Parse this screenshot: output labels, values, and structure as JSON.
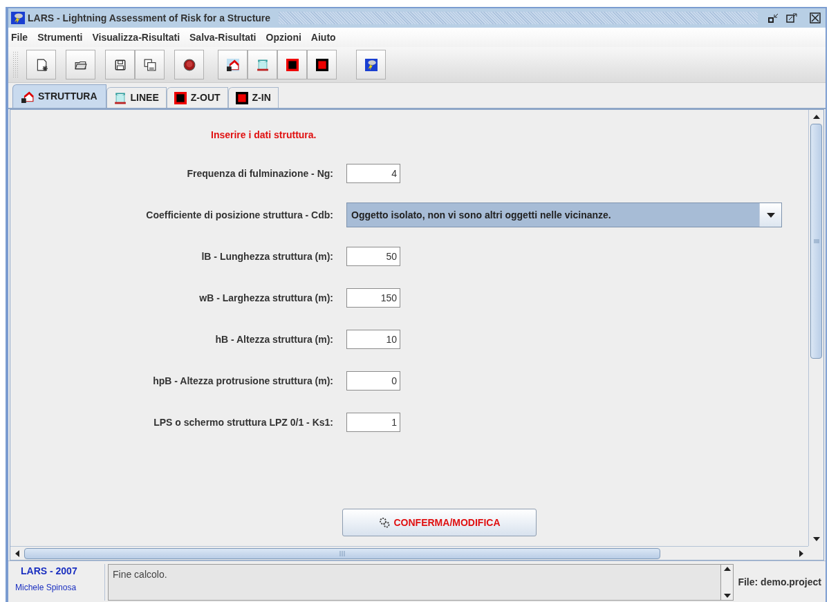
{
  "window": {
    "title": "LARS - Lightning Assessment of Risk for a Structure"
  },
  "menu": [
    {
      "label": "File"
    },
    {
      "label": "Strumenti"
    },
    {
      "label": "Visualizza-Risultati"
    },
    {
      "label": "Salva-Risultati"
    },
    {
      "label": "Opzioni"
    },
    {
      "label": "Aiuto"
    }
  ],
  "tabs": [
    {
      "label": "STRUTTURA",
      "selected": true
    },
    {
      "label": "LINEE",
      "selected": false
    },
    {
      "label": "Z-OUT",
      "selected": false
    },
    {
      "label": "Z-IN",
      "selected": false
    }
  ],
  "form": {
    "heading": "Inserire i dati struttura.",
    "fields": [
      {
        "kind": "text",
        "label": "Frequenza di fulminazione - Ng:",
        "value": "4"
      },
      {
        "kind": "select",
        "label": "Coefficiente di posizione struttura - Cdb:",
        "value": "Oggetto isolato, non vi sono altri oggetti nelle vicinanze."
      },
      {
        "kind": "text",
        "label": "lB - Lunghezza struttura (m):",
        "value": "50"
      },
      {
        "kind": "text",
        "label": "wB - Larghezza struttura (m):",
        "value": "150"
      },
      {
        "kind": "text",
        "label": "hB - Altezza struttura (m):",
        "value": "10"
      },
      {
        "kind": "text",
        "label": "hpB - Altezza protrusione struttura (m):",
        "value": "0"
      },
      {
        "kind": "text",
        "label": "LPS o schermo struttura  LPZ 0/1 - Ks1:",
        "value": "1"
      }
    ],
    "button": "CONFERMA/MODIFICA"
  },
  "status_bar": {
    "brand": "LARS - 2007",
    "author": "Michele Spinosa",
    "message": "Fine calcolo.",
    "file": "File: demo.project"
  }
}
